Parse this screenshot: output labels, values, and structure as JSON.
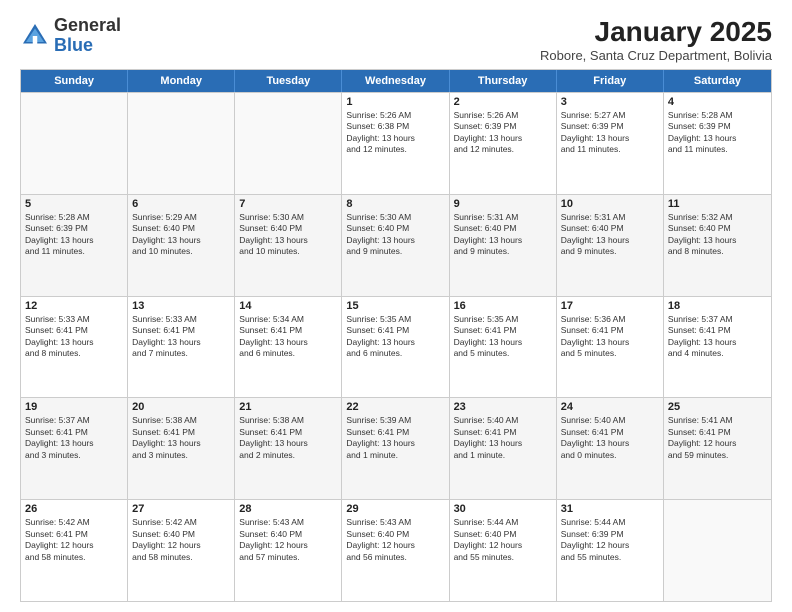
{
  "header": {
    "logo_general": "General",
    "logo_blue": "Blue",
    "month_title": "January 2025",
    "subtitle": "Robore, Santa Cruz Department, Bolivia"
  },
  "day_headers": [
    "Sunday",
    "Monday",
    "Tuesday",
    "Wednesday",
    "Thursday",
    "Friday",
    "Saturday"
  ],
  "weeks": [
    {
      "alt": false,
      "days": [
        {
          "num": "",
          "info": ""
        },
        {
          "num": "",
          "info": ""
        },
        {
          "num": "",
          "info": ""
        },
        {
          "num": "1",
          "info": "Sunrise: 5:26 AM\nSunset: 6:38 PM\nDaylight: 13 hours\nand 12 minutes."
        },
        {
          "num": "2",
          "info": "Sunrise: 5:26 AM\nSunset: 6:39 PM\nDaylight: 13 hours\nand 12 minutes."
        },
        {
          "num": "3",
          "info": "Sunrise: 5:27 AM\nSunset: 6:39 PM\nDaylight: 13 hours\nand 11 minutes."
        },
        {
          "num": "4",
          "info": "Sunrise: 5:28 AM\nSunset: 6:39 PM\nDaylight: 13 hours\nand 11 minutes."
        }
      ]
    },
    {
      "alt": true,
      "days": [
        {
          "num": "5",
          "info": "Sunrise: 5:28 AM\nSunset: 6:39 PM\nDaylight: 13 hours\nand 11 minutes."
        },
        {
          "num": "6",
          "info": "Sunrise: 5:29 AM\nSunset: 6:40 PM\nDaylight: 13 hours\nand 10 minutes."
        },
        {
          "num": "7",
          "info": "Sunrise: 5:30 AM\nSunset: 6:40 PM\nDaylight: 13 hours\nand 10 minutes."
        },
        {
          "num": "8",
          "info": "Sunrise: 5:30 AM\nSunset: 6:40 PM\nDaylight: 13 hours\nand 9 minutes."
        },
        {
          "num": "9",
          "info": "Sunrise: 5:31 AM\nSunset: 6:40 PM\nDaylight: 13 hours\nand 9 minutes."
        },
        {
          "num": "10",
          "info": "Sunrise: 5:31 AM\nSunset: 6:40 PM\nDaylight: 13 hours\nand 9 minutes."
        },
        {
          "num": "11",
          "info": "Sunrise: 5:32 AM\nSunset: 6:40 PM\nDaylight: 13 hours\nand 8 minutes."
        }
      ]
    },
    {
      "alt": false,
      "days": [
        {
          "num": "12",
          "info": "Sunrise: 5:33 AM\nSunset: 6:41 PM\nDaylight: 13 hours\nand 8 minutes."
        },
        {
          "num": "13",
          "info": "Sunrise: 5:33 AM\nSunset: 6:41 PM\nDaylight: 13 hours\nand 7 minutes."
        },
        {
          "num": "14",
          "info": "Sunrise: 5:34 AM\nSunset: 6:41 PM\nDaylight: 13 hours\nand 6 minutes."
        },
        {
          "num": "15",
          "info": "Sunrise: 5:35 AM\nSunset: 6:41 PM\nDaylight: 13 hours\nand 6 minutes."
        },
        {
          "num": "16",
          "info": "Sunrise: 5:35 AM\nSunset: 6:41 PM\nDaylight: 13 hours\nand 5 minutes."
        },
        {
          "num": "17",
          "info": "Sunrise: 5:36 AM\nSunset: 6:41 PM\nDaylight: 13 hours\nand 5 minutes."
        },
        {
          "num": "18",
          "info": "Sunrise: 5:37 AM\nSunset: 6:41 PM\nDaylight: 13 hours\nand 4 minutes."
        }
      ]
    },
    {
      "alt": true,
      "days": [
        {
          "num": "19",
          "info": "Sunrise: 5:37 AM\nSunset: 6:41 PM\nDaylight: 13 hours\nand 3 minutes."
        },
        {
          "num": "20",
          "info": "Sunrise: 5:38 AM\nSunset: 6:41 PM\nDaylight: 13 hours\nand 3 minutes."
        },
        {
          "num": "21",
          "info": "Sunrise: 5:38 AM\nSunset: 6:41 PM\nDaylight: 13 hours\nand 2 minutes."
        },
        {
          "num": "22",
          "info": "Sunrise: 5:39 AM\nSunset: 6:41 PM\nDaylight: 13 hours\nand 1 minute."
        },
        {
          "num": "23",
          "info": "Sunrise: 5:40 AM\nSunset: 6:41 PM\nDaylight: 13 hours\nand 1 minute."
        },
        {
          "num": "24",
          "info": "Sunrise: 5:40 AM\nSunset: 6:41 PM\nDaylight: 13 hours\nand 0 minutes."
        },
        {
          "num": "25",
          "info": "Sunrise: 5:41 AM\nSunset: 6:41 PM\nDaylight: 12 hours\nand 59 minutes."
        }
      ]
    },
    {
      "alt": false,
      "days": [
        {
          "num": "26",
          "info": "Sunrise: 5:42 AM\nSunset: 6:41 PM\nDaylight: 12 hours\nand 58 minutes."
        },
        {
          "num": "27",
          "info": "Sunrise: 5:42 AM\nSunset: 6:40 PM\nDaylight: 12 hours\nand 58 minutes."
        },
        {
          "num": "28",
          "info": "Sunrise: 5:43 AM\nSunset: 6:40 PM\nDaylight: 12 hours\nand 57 minutes."
        },
        {
          "num": "29",
          "info": "Sunrise: 5:43 AM\nSunset: 6:40 PM\nDaylight: 12 hours\nand 56 minutes."
        },
        {
          "num": "30",
          "info": "Sunrise: 5:44 AM\nSunset: 6:40 PM\nDaylight: 12 hours\nand 55 minutes."
        },
        {
          "num": "31",
          "info": "Sunrise: 5:44 AM\nSunset: 6:39 PM\nDaylight: 12 hours\nand 55 minutes."
        },
        {
          "num": "",
          "info": ""
        }
      ]
    }
  ]
}
